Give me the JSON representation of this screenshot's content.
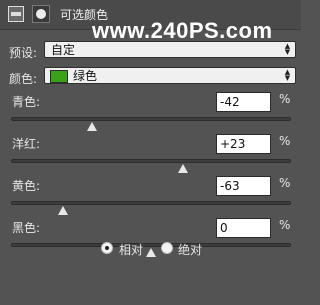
{
  "header": {
    "title": "可选颜色",
    "adjustment_icon": "adjustment-layer-icon",
    "mask_icon": "layer-mask-icon"
  },
  "watermark": "www.240PS.com",
  "preset": {
    "label": "预设:",
    "value": "自定"
  },
  "colors": {
    "label": "颜色:",
    "value": "绿色",
    "swatch_color": "#3aa21a"
  },
  "sliders": [
    {
      "label": "青色:",
      "value": "-42",
      "unit": "%",
      "level_percent": -42
    },
    {
      "label": "洋红:",
      "value": "+23",
      "unit": "%",
      "level_percent": 23
    },
    {
      "label": "黄色:",
      "value": "-63",
      "unit": "%",
      "level_percent": -63
    },
    {
      "label": "黑色:",
      "value": "0",
      "unit": "%",
      "level_percent": 0
    }
  ],
  "method": {
    "options": [
      {
        "label": "相对",
        "selected": true
      },
      {
        "label": "绝对",
        "selected": false
      }
    ]
  }
}
